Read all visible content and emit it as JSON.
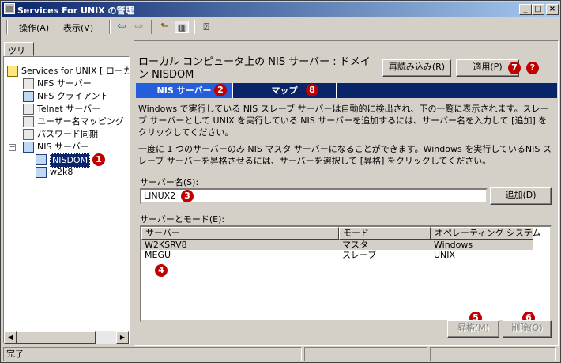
{
  "window": {
    "title": "Services For UNIX の管理"
  },
  "title_buttons": {
    "minimize": "_",
    "maximize": "□",
    "close": "×"
  },
  "menu": {
    "items": [
      "操作(A)",
      "表示(V)"
    ]
  },
  "toolbar": {
    "icons": [
      "back-arrow-icon",
      "forward-arrow-icon",
      "up-folder-icon",
      "show-hide-tree-icon",
      "help-icon"
    ]
  },
  "tree": {
    "tab_label": "ツリー",
    "items": [
      "Services for UNIX [ ローカ",
      "NFS サーバー",
      "NFS クライアント",
      "Telnet サーバー",
      "ユーザー名マッピング",
      "パスワード同期",
      "NIS サーバー",
      "NISDOM",
      "w2k8"
    ]
  },
  "main": {
    "heading": "ローカル コンピュータ上の NIS サーバー : ドメイン NISDOM",
    "reload_button": "再読み込み(R)",
    "apply_button": "適用(P)",
    "tabs": [
      "NIS サーバー",
      "マップ"
    ],
    "description_1": "Windows で実行している NIS スレーブ サーバーは自動的に検出され、下の一覧に表示されます。スレーブ サーバーとして UNIX を実行している NIS サーバーを追加するには、サーバー名を入力して [追加] をクリックしてください。",
    "description_2": "一度に 1 つのサーバーのみ NIS マスタ サーバーになることができます。Windows を実行しているNIS スレーブ サーバーを昇格させるには、サーバーを選択して [昇格] をクリックしてください。",
    "server_name_label": "サーバー名(S):",
    "server_name_value": "LINUX2",
    "add_button": "追加(D)",
    "list_label": "サーバーとモード(E):",
    "columns": [
      "サーバー",
      "モード",
      "オペレーティング システム"
    ],
    "rows": [
      [
        "W2KSRV8",
        "マスタ",
        "Windows"
      ],
      [
        "MEGU",
        "スレーブ",
        "UNIX"
      ]
    ],
    "promote_button": "昇格(M)",
    "delete_button": "削除(O)"
  },
  "badges": [
    "1",
    "2",
    "3",
    "4",
    "5",
    "6",
    "7",
    "8",
    "?"
  ],
  "status": {
    "text": "完了"
  },
  "colors": {
    "title_bar": "#0a246a",
    "tab_active": "#245edb",
    "badge": "#c00000",
    "selection": "#0a246a"
  }
}
